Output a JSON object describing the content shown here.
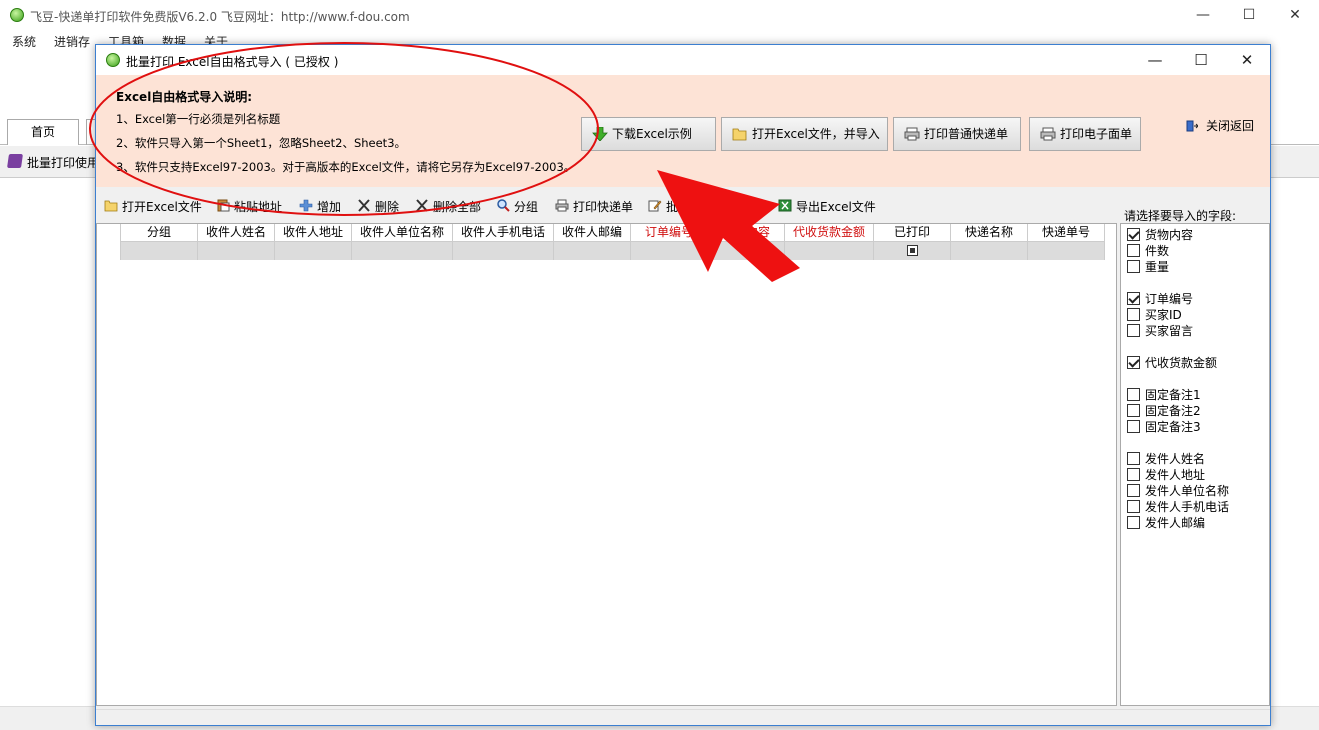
{
  "main_window": {
    "title": "飞豆-快递单打印软件免费版V6.2.0  飞豆网址：http://www.f-dou.com",
    "controls": {
      "minimize": "—",
      "maximize": "☐",
      "close": "✕"
    },
    "menu": [
      "系统",
      "进销存",
      "工具箱",
      "数据",
      "关于"
    ],
    "tabs": [
      "首页"
    ],
    "subbar_text": "批量打印使用"
  },
  "dialog": {
    "title": "批量打印   Excel自由格式导入 ( 已授权 )",
    "controls": {
      "minimize": "—",
      "maximize": "☐",
      "close": "✕"
    },
    "info": {
      "heading": "Excel自由格式导入说明:",
      "lines": [
        "1、Excel第一行必须是列名标题",
        "2、软件只导入第一个Sheet1，忽略Sheet2、Sheet3。",
        "3、软件只支持Excel97-2003。对于高版本的Excel文件，请将它另存为Excel97-2003。"
      ]
    },
    "buttons": {
      "download_example": "下载Excel示例",
      "open_import": "打开Excel文件，并导入",
      "print_normal": "打印普通快递单",
      "print_electronic": "打印电子面单"
    },
    "close_back": "关闭返回",
    "toolbar": {
      "open_excel": "打开Excel文件",
      "paste_address": "粘贴地址",
      "add": "增加",
      "delete": "删除",
      "delete_all": "删除全部",
      "group": "分组",
      "print_express": "打印快递单",
      "batch_number": "批",
      "express_number": "递单号",
      "export_excel": "导出Excel文件"
    },
    "grid": {
      "columns": [
        {
          "label": "分组",
          "red": false
        },
        {
          "label": "收件人姓名",
          "red": false
        },
        {
          "label": "收件人地址",
          "red": false
        },
        {
          "label": "收件人单位名称",
          "red": false
        },
        {
          "label": "收件人手机电话",
          "red": false
        },
        {
          "label": "收件人邮编",
          "red": false
        },
        {
          "label": "订单编号",
          "red": true
        },
        {
          "label": "货物内容",
          "red": true
        },
        {
          "label": "代收货款金额",
          "red": true
        },
        {
          "label": "已打印",
          "red": false
        },
        {
          "label": "快递名称",
          "red": false
        },
        {
          "label": "快递单号",
          "red": false
        }
      ]
    },
    "fields_label": "请选择要导入的字段:",
    "fields": [
      {
        "label": "货物内容",
        "checked": true,
        "group": 0
      },
      {
        "label": "件数",
        "checked": false,
        "group": 0
      },
      {
        "label": "重量",
        "checked": false,
        "group": 0
      },
      {
        "label": "订单编号",
        "checked": true,
        "group": 1
      },
      {
        "label": "买家ID",
        "checked": false,
        "group": 1
      },
      {
        "label": "买家留言",
        "checked": false,
        "group": 1
      },
      {
        "label": "代收货款金额",
        "checked": true,
        "group": 2
      },
      {
        "label": "固定备注1",
        "checked": false,
        "group": 3
      },
      {
        "label": "固定备注2",
        "checked": false,
        "group": 3
      },
      {
        "label": "固定备注3",
        "checked": false,
        "group": 3
      },
      {
        "label": "发件人姓名",
        "checked": false,
        "group": 4
      },
      {
        "label": "发件人地址",
        "checked": false,
        "group": 4
      },
      {
        "label": "发件人单位名称",
        "checked": false,
        "group": 4
      },
      {
        "label": "发件人手机电话",
        "checked": false,
        "group": 4
      },
      {
        "label": "发件人邮编",
        "checked": false,
        "group": 4
      }
    ]
  },
  "annotation_colors": {
    "ellipse": "#e01010",
    "arrow": "#ee1111"
  }
}
